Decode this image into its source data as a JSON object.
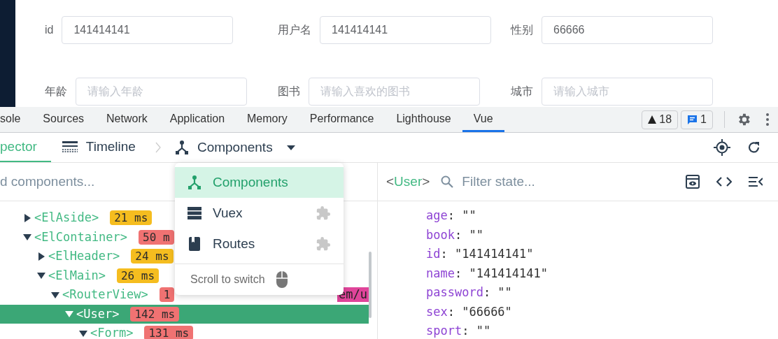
{
  "form": {
    "rows": [
      {
        "fields": [
          {
            "label": "id",
            "value": "141414141"
          },
          {
            "label": "用户名",
            "value": "141414141"
          },
          {
            "label": "性别",
            "value": "66666"
          }
        ]
      },
      {
        "fields": [
          {
            "label": "年龄",
            "placeholder": "请输入年龄"
          },
          {
            "label": "图书",
            "placeholder": "请输入喜欢的图书"
          },
          {
            "label": "城市",
            "placeholder": "请输入城市"
          }
        ]
      }
    ]
  },
  "devtools_tabs": [
    {
      "label": "sole",
      "selected": false
    },
    {
      "label": "Sources",
      "selected": false
    },
    {
      "label": "Network",
      "selected": false
    },
    {
      "label": "Application",
      "selected": false
    },
    {
      "label": "Memory",
      "selected": false
    },
    {
      "label": "Performance",
      "selected": false
    },
    {
      "label": "Lighthouse",
      "selected": false
    },
    {
      "label": "Vue",
      "selected": true
    }
  ],
  "issues": {
    "warnings": "18",
    "messages": "1"
  },
  "vue_tabs": [
    {
      "label": "pector",
      "kind": "inspector",
      "selected": true
    },
    {
      "label": "Timeline",
      "kind": "timeline",
      "selected": false
    }
  ],
  "breadcrumb": {
    "label": "Components"
  },
  "tree_search": {
    "placeholder": "d components..."
  },
  "tree": [
    {
      "name": "<ElAside>",
      "expanded": false,
      "selected": false,
      "badge": {
        "text": "21 ms",
        "color": "#f5bd1f"
      }
    },
    {
      "name": "<ElContainer>",
      "expanded": true,
      "selected": false,
      "badge": {
        "text": "50 m",
        "color": "#f07272"
      },
      "children": [
        {
          "name": "<ElHeader>",
          "expanded": false,
          "selected": false,
          "badge": {
            "text": "24 ms",
            "color": "#f5bd1f"
          }
        },
        {
          "name": "<ElMain>",
          "expanded": true,
          "selected": false,
          "badge": {
            "text": "26 ms",
            "color": "#f5bd1f"
          },
          "children": [
            {
              "name": "<RouterView>",
              "expanded": true,
              "selected": false,
              "badge": {
                "text": "1",
                "color": "#f07272"
              },
              "tag": "em/u",
              "children": [
                {
                  "name": "<User>",
                  "expanded": true,
                  "selected": true,
                  "badge": {
                    "text": "142 ms",
                    "color": "#f07272"
                  },
                  "children": [
                    {
                      "name": "<Form>",
                      "expanded": true,
                      "selected": false,
                      "badge": {
                        "text": "131 ms",
                        "color": "#f07272"
                      }
                    }
                  ]
                }
              ]
            }
          ]
        }
      ]
    }
  ],
  "dropdown": {
    "items": [
      {
        "label": "Components",
        "kind": "components",
        "selected": true,
        "plugin": false
      },
      {
        "label": "Vuex",
        "kind": "vuex",
        "selected": false,
        "plugin": true
      },
      {
        "label": "Routes",
        "kind": "routes",
        "selected": false,
        "plugin": true
      }
    ],
    "hint": "Scroll to switch"
  },
  "state_panel": {
    "title_open": "<",
    "component": "User",
    "title_close": ">",
    "filter_placeholder": "Filter state...",
    "entries": [
      {
        "key": "age",
        "value": ": \"\""
      },
      {
        "key": "book",
        "value": ": \"\""
      },
      {
        "key": "id",
        "value": ": \"141414141\""
      },
      {
        "key": "name",
        "value": ": \"141414141\""
      },
      {
        "key": "password",
        "value": ": \"\""
      },
      {
        "key": "sex",
        "value": ": \"66666\""
      },
      {
        "key": "sport",
        "value": ": \"\""
      }
    ]
  }
}
